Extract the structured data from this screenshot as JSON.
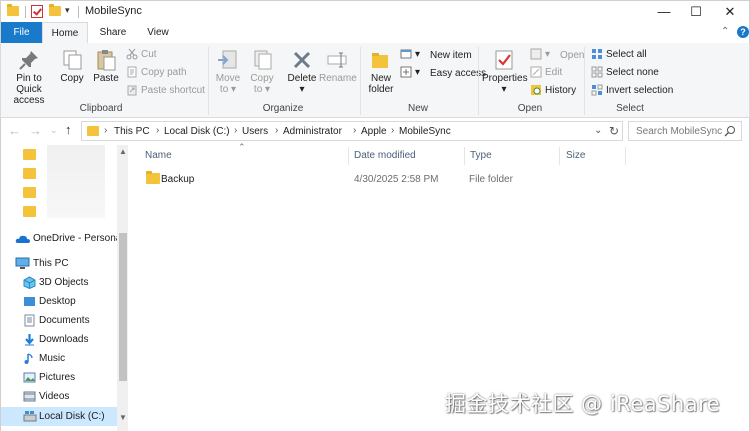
{
  "window": {
    "title": "MobileSync",
    "controls": {
      "minimize": "—",
      "maximize": "☐",
      "close": "✕"
    }
  },
  "ribbon_tabs": [
    "File",
    "Home",
    "Share",
    "View"
  ],
  "ribbon": {
    "clipboard": {
      "label": "Clipboard",
      "pin": [
        "Pin to Quick",
        "access"
      ],
      "copy": "Copy",
      "paste": "Paste",
      "cut": "Cut",
      "copy_path": "Copy path",
      "paste_shortcut": "Paste shortcut"
    },
    "organize": {
      "label": "Organize",
      "move_to": [
        "Move",
        "to"
      ],
      "copy_to": [
        "Copy",
        "to"
      ],
      "delete": "Delete",
      "rename": "Rename"
    },
    "new": {
      "label": "New",
      "new_folder": [
        "New",
        "folder"
      ],
      "new_item": "New item",
      "easy_access": "Easy access"
    },
    "open": {
      "label": "Open",
      "properties": "Properties",
      "open": "Open",
      "edit": "Edit",
      "history": "History"
    },
    "select": {
      "label": "Select",
      "select_all": "Select all",
      "select_none": "Select none",
      "invert": "Invert selection"
    }
  },
  "address_bar": {
    "crumbs": [
      "This PC",
      "Local Disk (C:)",
      "Users",
      "Administrator",
      "Apple",
      "MobileSync"
    ],
    "search_placeholder": "Search MobileSync"
  },
  "nav_pane": {
    "items": [
      {
        "label": "OneDrive - Persona",
        "icon": "cloud-icon"
      },
      {
        "label": "This PC",
        "icon": "monitor-icon"
      },
      {
        "label": "3D Objects",
        "icon": "cube-icon"
      },
      {
        "label": "Desktop",
        "icon": "desktop-icon"
      },
      {
        "label": "Documents",
        "icon": "document-icon"
      },
      {
        "label": "Downloads",
        "icon": "download-icon"
      },
      {
        "label": "Music",
        "icon": "music-icon"
      },
      {
        "label": "Pictures",
        "icon": "picture-icon"
      },
      {
        "label": "Videos",
        "icon": "video-icon"
      },
      {
        "label": "Local Disk (C:)",
        "icon": "drive-icon"
      }
    ]
  },
  "file_list": {
    "columns": [
      "Name",
      "Date modified",
      "Type",
      "Size"
    ],
    "rows": [
      {
        "name": "Backup",
        "date_modified": "4/30/2025 2:58 PM",
        "type": "File folder",
        "size": ""
      }
    ]
  },
  "watermark": "掘金技术社区 @ iReaShare",
  "colors": {
    "accent": "#1979ca",
    "folder": "#f4c33c",
    "selected": "#cce8ff",
    "column_header": "#4c607a"
  }
}
